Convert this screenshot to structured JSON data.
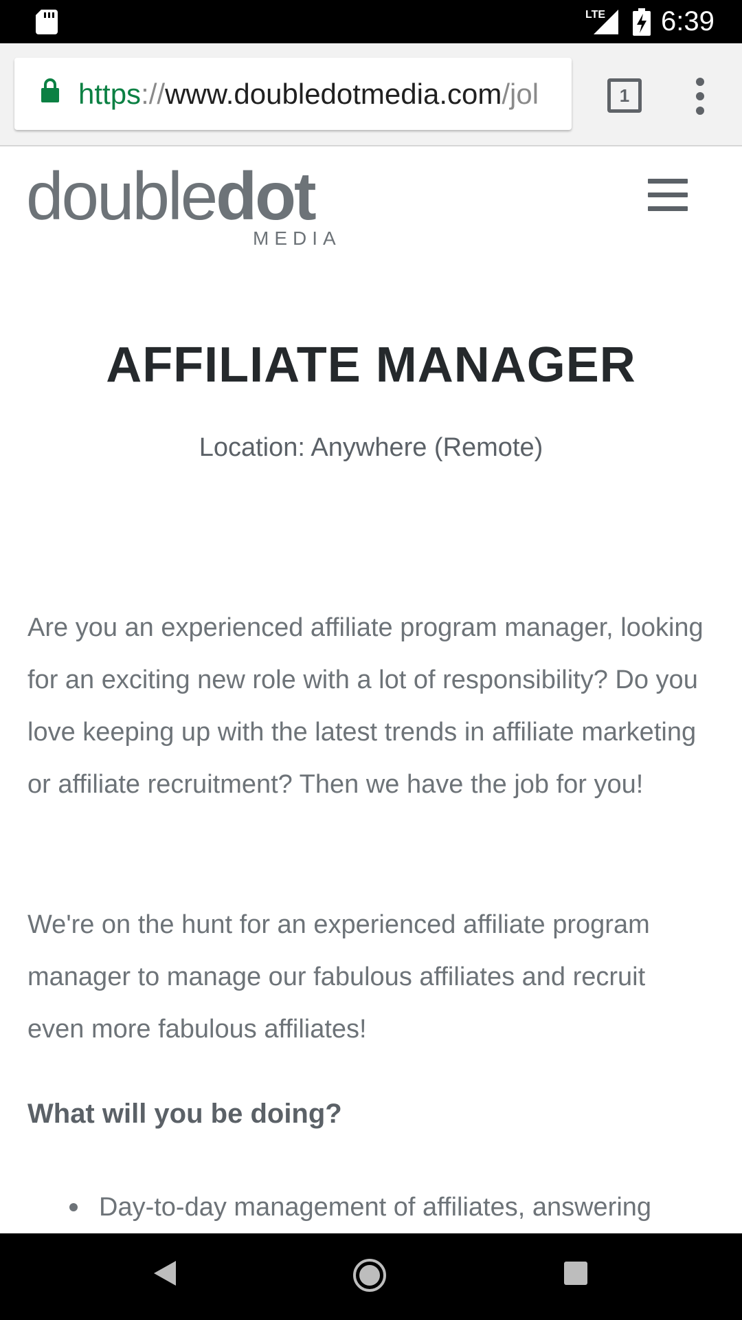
{
  "status_bar": {
    "time": "6:39",
    "network": "LTE"
  },
  "browser": {
    "url_scheme": "https",
    "url_sep": "://",
    "url_host": "www.doubledotmedia.com",
    "url_path": "/jol",
    "tab_count": "1"
  },
  "site": {
    "logo_light": "double",
    "logo_bold": "dot",
    "logo_sub": "MEDIA"
  },
  "job": {
    "title": "AFFILIATE MANAGER",
    "location": "Location: Anywhere (Remote)",
    "paragraph1": "Are you an experienced affiliate program manager, looking for an exciting new role with a lot of responsibility? Do you love keeping up with the latest trends in affiliate marketing or affiliate recruitment? Then we have the job for you!",
    "paragraph2": "We're on the hunt for an experienced affiliate program manager to manage our fabulous affiliates and recruit even more fabulous affiliates!",
    "section_heading": "What will you be doing?",
    "bullets": [
      "Day-to-day management of affiliates, answering"
    ]
  },
  "colors": {
    "url_scheme": "#0b8043",
    "text_body": "#6d7378",
    "title": "#25292c"
  }
}
